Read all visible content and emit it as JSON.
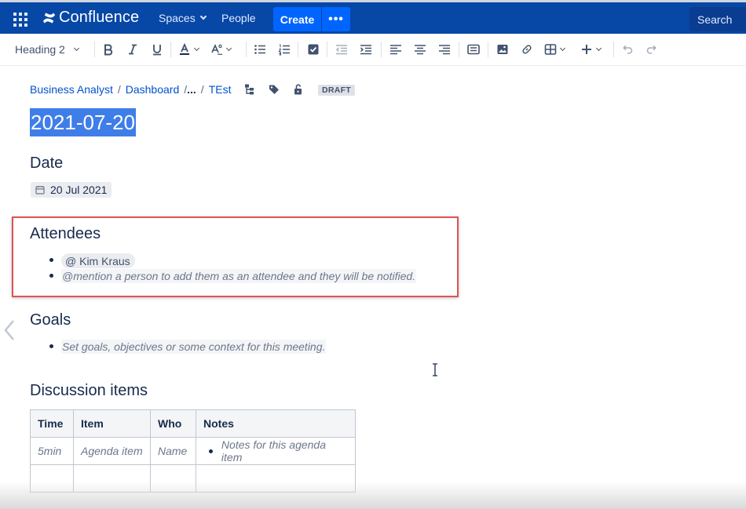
{
  "topnav": {
    "app_name": "Confluence",
    "spaces_label": "Spaces",
    "people_label": "People",
    "create_label": "Create",
    "more_label": "•••",
    "search_label": "Search"
  },
  "toolbar": {
    "heading_style": "Heading 2",
    "icons": [
      "bold-icon",
      "italic-icon",
      "underline-icon",
      "text-color-icon",
      "text-formatting-icon",
      "bullet-list-icon",
      "numbered-list-icon",
      "task-list-icon",
      "outdent-icon",
      "indent-icon",
      "align-left-icon",
      "align-center-icon",
      "align-right-icon",
      "page-layout-icon",
      "image-icon",
      "link-icon",
      "table-icon",
      "insert-icon",
      "undo-icon",
      "redo-icon"
    ]
  },
  "breadcrumb": {
    "items": [
      "Business Analyst",
      "Dashboard",
      "...",
      "TEst"
    ],
    "separator": "/",
    "status": "DRAFT"
  },
  "page": {
    "title": "2021-07-20"
  },
  "date_section": {
    "heading": "Date",
    "value": "20 Jul 2021"
  },
  "attendees_section": {
    "heading": "Attendees",
    "mention": "@ Kim Kraus",
    "placeholder": "@mention a person to add them as an attendee and they will be notified."
  },
  "goals_section": {
    "heading": "Goals",
    "placeholder": "Set goals, objectives or some context for this meeting."
  },
  "discussion_section": {
    "heading": "Discussion items",
    "columns": [
      "Time",
      "Item",
      "Who",
      "Notes"
    ],
    "rows": [
      {
        "time": "5min",
        "item": "Agenda item",
        "who": "Name",
        "notes": "Notes for this agenda item"
      },
      {
        "time": "",
        "item": "",
        "who": "",
        "notes": ""
      }
    ]
  },
  "colors": {
    "nav_bg": "#0747a6",
    "create_bg": "#0065ff",
    "link": "#0052cc",
    "title_highlight": "#3f7ee8",
    "callout_border": "#e05252"
  }
}
